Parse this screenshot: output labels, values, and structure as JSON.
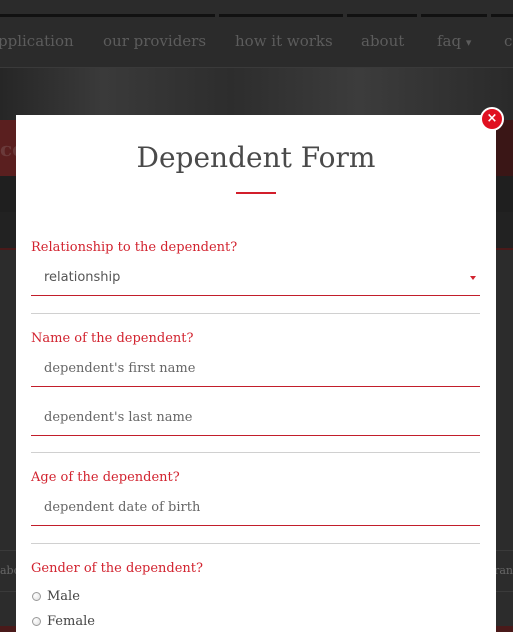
{
  "nav": {
    "items": [
      "pplication",
      "our providers",
      "how it works",
      "about",
      "faq",
      "c"
    ],
    "faq_caret": "▾"
  },
  "background": {
    "redbar_text": "ce",
    "side_left": "abo",
    "side_right": "ran"
  },
  "modal": {
    "close_symbol": "×",
    "title": "Dependent Form",
    "relationship": {
      "label": "Relationship to the dependent?",
      "selected": "relationship"
    },
    "name": {
      "label": "Name of the dependent?",
      "first_placeholder": "dependent's first name",
      "last_placeholder": "dependent's last name"
    },
    "age": {
      "label": "Age of the dependent?",
      "placeholder": "dependent date of birth"
    },
    "gender": {
      "label": "Gender of the dependent?",
      "options": [
        "Male",
        "Female"
      ]
    }
  },
  "colors": {
    "accent": "#d2232f",
    "close": "#e01020"
  }
}
